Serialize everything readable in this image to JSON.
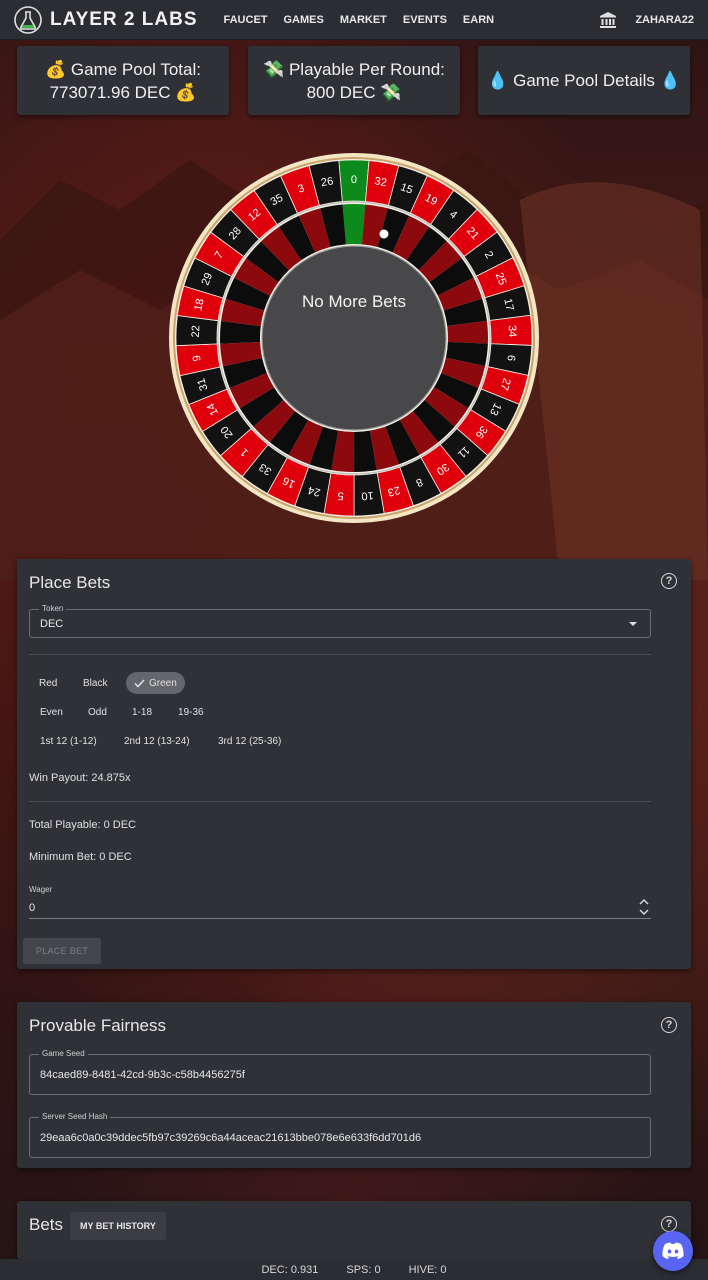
{
  "brand": {
    "name": "LAYER 2 LABS"
  },
  "nav": {
    "items": [
      "FAUCET",
      "GAMES",
      "MARKET",
      "EVENTS",
      "EARN"
    ]
  },
  "user": {
    "name": "ZAHARA22"
  },
  "stats": {
    "pool_total": "💰 Game Pool Total: 773071.96 DEC 💰",
    "playable_per_round": "💸 Playable Per Round: 800 DEC 💸",
    "pool_details": "💧 Game Pool Details 💧"
  },
  "wheel": {
    "status": "No More Bets",
    "numbers": [
      "0",
      "32",
      "15",
      "19",
      "4",
      "21",
      "2",
      "25",
      "17",
      "34",
      "6",
      "27",
      "13",
      "36",
      "11",
      "30",
      "8",
      "23",
      "10",
      "5",
      "24",
      "16",
      "33",
      "1",
      "20",
      "14",
      "31",
      "9",
      "22",
      "18",
      "29",
      "7",
      "28",
      "12",
      "35",
      "3",
      "26"
    ],
    "colors": {
      "green": "#0c8a1c",
      "red": "#e0000c",
      "black": "#121212"
    }
  },
  "place_bets": {
    "title": "Place Bets",
    "token_label": "Token",
    "token_value": "DEC",
    "options_row1": [
      "Red",
      "Black",
      "Green"
    ],
    "options_row2": [
      "Even",
      "Odd",
      "1-18",
      "19-36"
    ],
    "options_row3": [
      "1st 12 (1-12)",
      "2nd 12 (13-24)",
      "3rd 12 (25-36)"
    ],
    "selected_option": "Green",
    "win_payout": "Win Payout: 24.875x",
    "total_playable": "Total Playable: 0 DEC",
    "minimum_bet": "Minimum Bet: 0 DEC",
    "wager_label": "Wager",
    "wager_value": "0",
    "place_bet_label": "PLACE BET"
  },
  "fairness": {
    "title": "Provable Fairness",
    "game_seed_label": "Game Seed",
    "game_seed_value": "84caed89-8481-42cd-9b3c-c58b4456275f",
    "server_hash_label": "Server Seed Hash",
    "server_hash_value": "29eaa6c0a0c39ddec5fb97c39269c6a44aceac21613bbe078e6e633f6dd701d6"
  },
  "bets": {
    "title": "Bets",
    "history_label": "MY BET HISTORY"
  },
  "footer": {
    "dec": "DEC: 0.931",
    "sps": "SPS: 0",
    "hive": "HIVE: 0"
  }
}
